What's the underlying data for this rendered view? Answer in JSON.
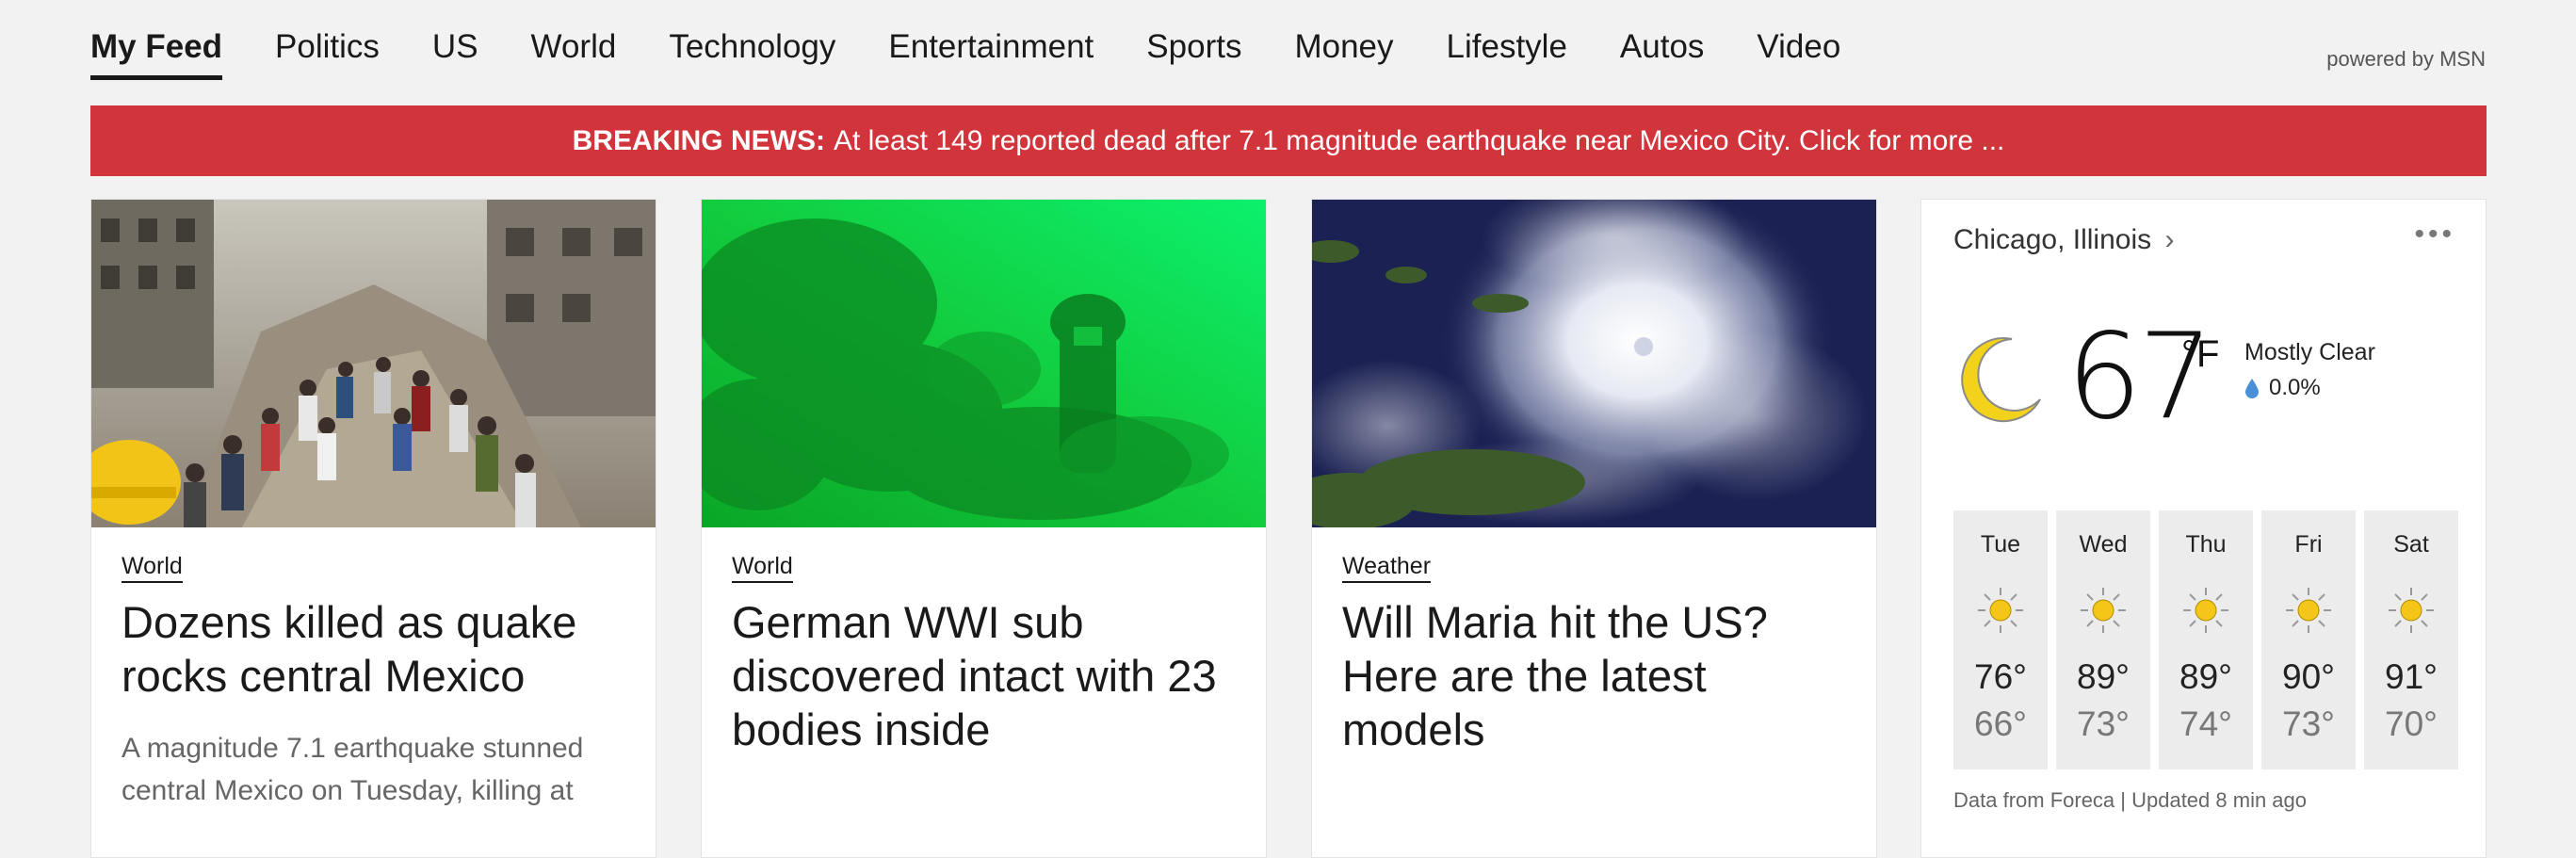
{
  "nav": {
    "items": [
      "My Feed",
      "Politics",
      "US",
      "World",
      "Technology",
      "Entertainment",
      "Sports",
      "Money",
      "Lifestyle",
      "Autos",
      "Video"
    ],
    "active": "My Feed",
    "powered_by": "powered by MSN"
  },
  "breaking": {
    "label": "BREAKING NEWS:",
    "text": "At least 149 reported dead after 7.1 magnitude earthquake near Mexico City. Click for more ..."
  },
  "cards": [
    {
      "category": "World",
      "title": "Dozens killed as quake rocks central Mexico",
      "description": "A magnitude 7.1 earthquake stunned central Mexico on Tuesday, killing at"
    },
    {
      "category": "World",
      "title": "German WWI sub discovered intact with 23 bodies inside",
      "description": ""
    },
    {
      "category": "Weather",
      "title": "Will Maria hit the US? Here are the latest models",
      "description": ""
    }
  ],
  "weather": {
    "location": "Chicago, Illinois",
    "chevron": "›",
    "more": "•••",
    "temp": "67",
    "unit": "°F",
    "condition": "Mostly Clear",
    "precip": "0.0%",
    "forecast": [
      {
        "day": "Tue",
        "hi": "76°",
        "lo": "66°"
      },
      {
        "day": "Wed",
        "hi": "89°",
        "lo": "73°"
      },
      {
        "day": "Thu",
        "hi": "89°",
        "lo": "74°"
      },
      {
        "day": "Fri",
        "hi": "90°",
        "lo": "73°"
      },
      {
        "day": "Sat",
        "hi": "91°",
        "lo": "70°"
      }
    ],
    "footer": "Data from Foreca | Updated 8 min ago"
  },
  "colors": {
    "breaking_bg": "#d1343b",
    "sun": "#f5c518",
    "moon": "#f2d21b"
  }
}
